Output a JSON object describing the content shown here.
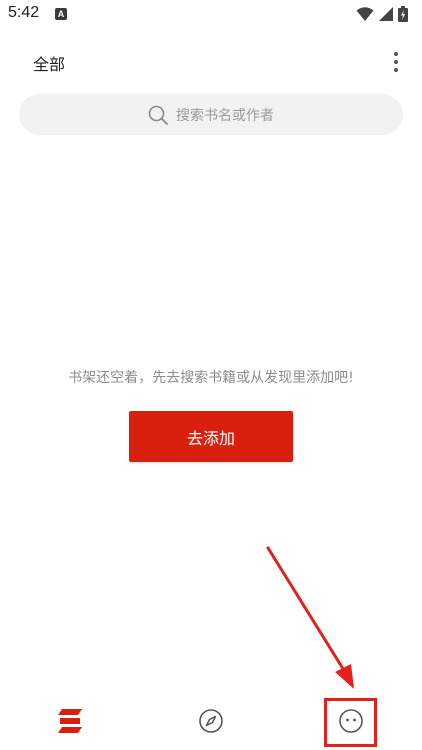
{
  "status_bar": {
    "time": "5:42",
    "app_icon_letter": "A"
  },
  "header": {
    "title": "全部"
  },
  "search": {
    "placeholder": "搜索书名或作者"
  },
  "empty_state": {
    "message": "书架还空着，先去搜索书籍或从发现里添加吧!",
    "button_label": "去添加"
  },
  "bottom_nav": {
    "items": [
      {
        "id": "bookshelf",
        "icon": "bookshelf-icon",
        "active": true
      },
      {
        "id": "discover",
        "icon": "compass-icon",
        "active": false
      },
      {
        "id": "profile",
        "icon": "face-icon",
        "active": false
      }
    ]
  },
  "colors": {
    "accent": "#d9200f",
    "annotation": "#e5201b",
    "search_bg": "#f2f2f2",
    "placeholder": "#9a9a9a"
  }
}
